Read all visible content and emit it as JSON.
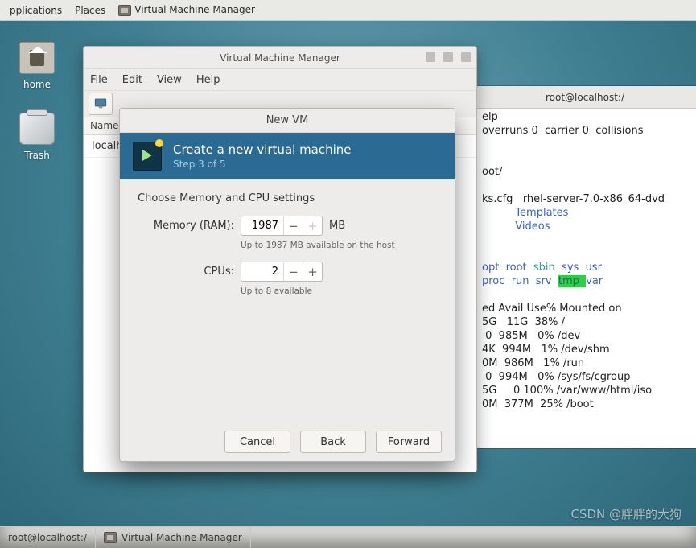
{
  "topbar": {
    "applications": "pplications",
    "places": "Places",
    "active": "Virtual Machine Manager"
  },
  "desktop": {
    "home": "home",
    "trash": "Trash"
  },
  "terminal": {
    "title": "root@localhost:/",
    "l1": "elp",
    "l2": "overruns 0  carrier 0  collisions",
    "l3": "oot/",
    "l4a": "ks.cfg   ",
    "l4b": "rhel-server-7.0-x86_64-dvd",
    "l5": "Templates",
    "l6": "Videos",
    "l7a": "opt  ",
    "l7b": "root  ",
    "l7c": "sbin  ",
    "l7d": "sys  ",
    "l7e": "usr",
    "l8a": "proc  ",
    "l8b": "run  ",
    "l8c": "srv  ",
    "l8d": "tmp  ",
    "l8e": "var",
    "l9": "ed Avail Use% Mounted on",
    "l10": "5G   11G  38% /",
    "l11": " 0  985M   0% /dev",
    "l12": "4K  994M   1% /dev/shm",
    "l13": "0M  986M   1% /run",
    "l14": " 0  994M   0% /sys/fs/cgroup",
    "l15": "5G     0 100% /var/www/html/iso",
    "l16": "0M  377M  25% /boot"
  },
  "vmm": {
    "title": "Virtual Machine Manager",
    "menu": {
      "file": "File",
      "edit": "Edit",
      "view": "View",
      "help": "Help"
    },
    "list_head": "Name",
    "row0": "localhost"
  },
  "dialog": {
    "title": "New VM",
    "heading": "Create a new virtual machine",
    "step": "Step 3 of 5",
    "section": "Choose Memory and CPU settings",
    "mem_label": "Memory (RAM):",
    "mem_value": "1987",
    "mem_unit": "MB",
    "mem_hint": "Up to 1987 MB available on the host",
    "cpu_label": "CPUs:",
    "cpu_value": "2",
    "cpu_hint": "Up to 8 available",
    "btn_cancel": "Cancel",
    "btn_back": "Back",
    "btn_forward": "Forward"
  },
  "taskbar": {
    "t0": "root@localhost:/",
    "t1": "Virtual Machine Manager"
  },
  "watermark": "CSDN @胖胖的大狗"
}
